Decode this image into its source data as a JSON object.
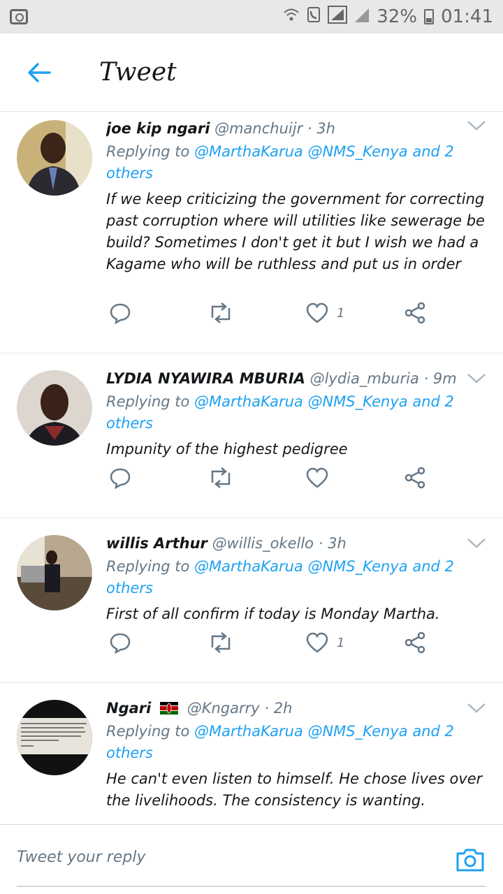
{
  "status_bar": {
    "battery": "32%",
    "time": "01:41"
  },
  "header": {
    "title": "Tweet",
    "back_icon": "arrow-left-icon"
  },
  "tweets": [
    {
      "name": "joe kip ngari",
      "handle": "@manchuijr",
      "sep": "·",
      "time": "3h",
      "replying_prefix": "Replying to",
      "replying_to": "@MarthaKarua @NMS_Kenya and 2",
      "replying_more": "others",
      "text": "If we keep criticizing the government for correcting past corruption where will utilities like sewerage be build? Sometimes I don't get it but I wish we had a Kagame who will be ruthless and put us in order",
      "likes": "1",
      "retweets": ""
    },
    {
      "name": "LYDIA NYAWIRA MBURIA",
      "handle": "@lydia_mburia",
      "sep": "·",
      "time": "9m",
      "replying_prefix": "Replying to",
      "replying_to": "@MarthaKarua @NMS_Kenya and 2",
      "replying_more": "others",
      "text": "Impunity of the highest pedigree",
      "likes": "",
      "retweets": ""
    },
    {
      "name": "willis Arthur",
      "handle": "@willis_okello",
      "sep": "·",
      "time": "3h",
      "replying_prefix": "Replying to",
      "replying_to": "@MarthaKarua @NMS_Kenya and 2",
      "replying_more": "others",
      "text": "First of all confirm if today is Monday Martha.",
      "likes": "1",
      "retweets": ""
    },
    {
      "name": "Ngari",
      "handle": "@Kngarry",
      "sep": "·",
      "time": "2h",
      "replying_prefix": "Replying to",
      "replying_to": "@MarthaKarua @NMS_Kenya and 2",
      "replying_more": "others",
      "text": "He can't even listen to himself. He chose lives over the livelihoods. The consistency is wanting.",
      "likes": "",
      "retweets": ""
    }
  ],
  "composer": {
    "placeholder": "Tweet your reply"
  },
  "colors": {
    "accent": "#1da1f2",
    "muted": "#657786",
    "divider": "#e1e8ed"
  }
}
